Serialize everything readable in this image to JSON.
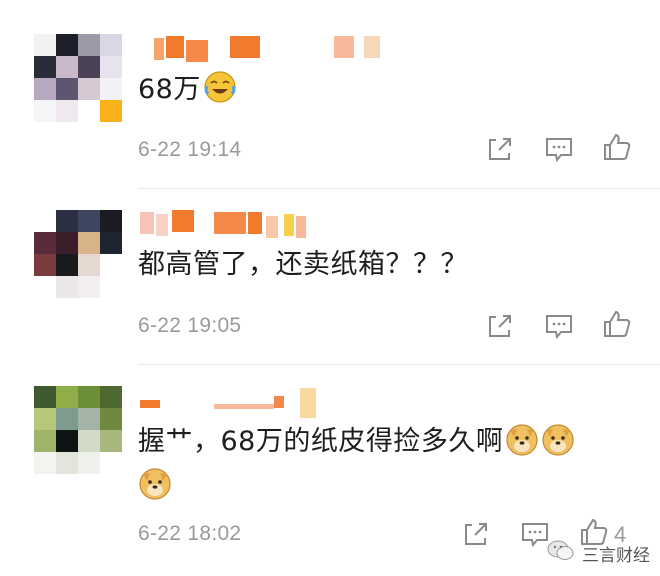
{
  "comments": [
    {
      "text": "68万",
      "time": "6-22 19:14",
      "emoji": "laugh-cry-emoji"
    },
    {
      "text": "都高管了，还卖纸箱？？？",
      "time": "6-22 19:05"
    },
    {
      "text": "握艹，68万的纸皮得捡多久啊",
      "time": "6-22 18:02",
      "like_count": "4",
      "emoji": "doge-emoji"
    }
  ],
  "watermark": {
    "text": "三言财经",
    "icon": "wechat-icon"
  },
  "icons": {
    "share": "share-icon",
    "comment": "comment-icon",
    "like": "thumbs-up-icon"
  },
  "colors": {
    "text": "#1e1e1e",
    "meta": "#9a9a9a",
    "emoji_yellow": "#f6c437",
    "nickname_blur": "#f07b2d"
  }
}
